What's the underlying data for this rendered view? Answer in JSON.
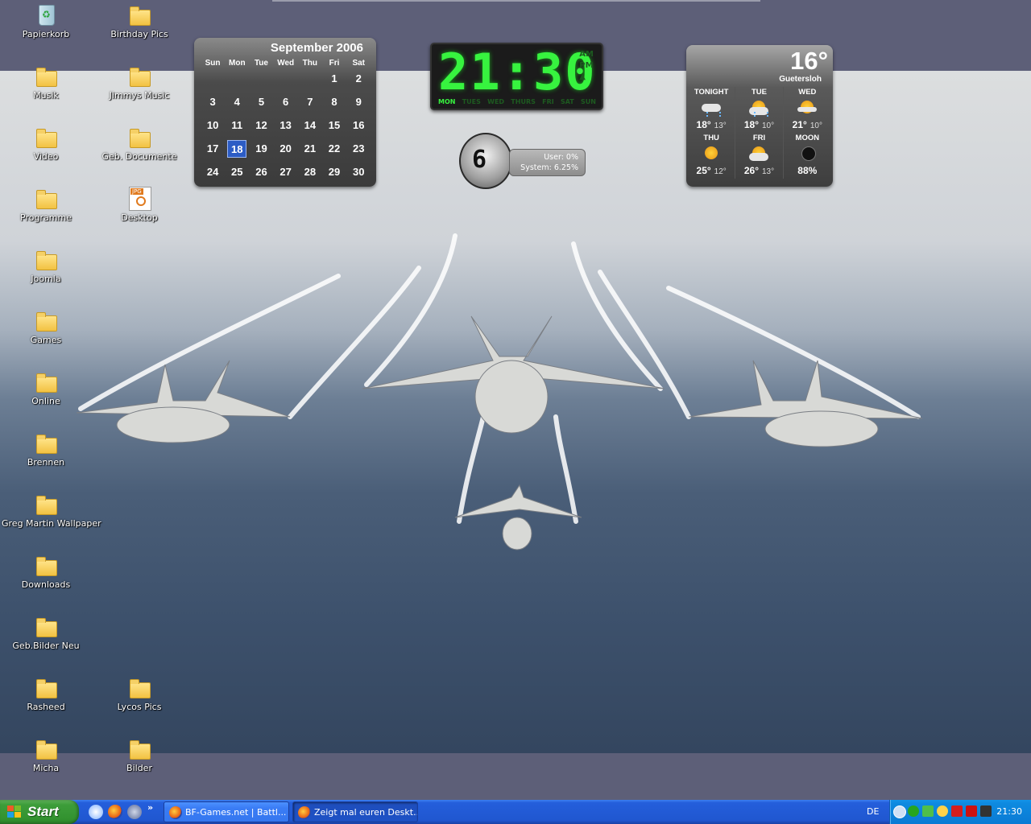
{
  "desktop_icons": [
    {
      "label": "Papierkorb",
      "type": "recycle-bin"
    },
    {
      "label": "Birthday Pics",
      "type": "folder"
    },
    {
      "label": "Musik",
      "type": "folder"
    },
    {
      "label": "Jimmys Music",
      "type": "folder"
    },
    {
      "label": "Video",
      "type": "folder"
    },
    {
      "label": "Geb. Documente",
      "type": "folder"
    },
    {
      "label": "Programme",
      "type": "folder"
    },
    {
      "label": "Desktop",
      "type": "jpg-file"
    },
    {
      "label": "Joomla",
      "type": "folder"
    },
    {
      "label": "Games",
      "type": "folder"
    },
    {
      "label": "Online",
      "type": "folder"
    },
    {
      "label": "Brennen",
      "type": "folder"
    },
    {
      "label": "Greg Martin Wallpaper",
      "type": "folder"
    },
    {
      "label": "Downloads",
      "type": "folder"
    },
    {
      "label": "Geb.Bilder Neu",
      "type": "folder"
    },
    {
      "label": "Rasheed",
      "type": "folder"
    },
    {
      "label": "Lycos Pics",
      "type": "folder"
    },
    {
      "label": "Micha",
      "type": "folder"
    },
    {
      "label": "Bilder",
      "type": "folder"
    }
  ],
  "calendar": {
    "month": "September 2006",
    "weekdays": [
      "Sun",
      "Mon",
      "Tue",
      "Wed",
      "Thu",
      "Fri",
      "Sat"
    ],
    "days": [
      "",
      "",
      "",
      "",
      "",
      "1",
      "2",
      "3",
      "4",
      "5",
      "6",
      "7",
      "8",
      "9",
      "10",
      "11",
      "12",
      "13",
      "14",
      "15",
      "16",
      "17",
      "18",
      "19",
      "20",
      "21",
      "22",
      "23",
      "24",
      "25",
      "26",
      "27",
      "28",
      "29",
      "30"
    ],
    "today": "18",
    "highlight_color": "#2c5cc5"
  },
  "clock": {
    "time": "21:30",
    "am": "AM",
    "pm": "PM",
    "days": [
      "MON",
      "TUES",
      "WED",
      "THURS",
      "FRI",
      "SAT",
      "SUN"
    ],
    "active_day": "MON",
    "digit_color": "#37f33f"
  },
  "cpu_meter": {
    "value": "6",
    "user": "User: 0%",
    "system": "System: 6.25%"
  },
  "weather": {
    "current_temp": "16°",
    "city": "Guetersloh",
    "forecast": [
      {
        "day": "TONIGHT",
        "high": "18°",
        "low": "13°",
        "icon": "rain-cloud-icon"
      },
      {
        "day": "TUE",
        "high": "18°",
        "low": "10°",
        "icon": "sun-rain-icon"
      },
      {
        "day": "WED",
        "high": "21°",
        "low": "10°",
        "icon": "sun-cloud-icon"
      },
      {
        "day": "THU",
        "high": "25°",
        "low": "12°",
        "icon": "sun-icon"
      },
      {
        "day": "FRI",
        "high": "26°",
        "low": "13°",
        "icon": "sun-cloud-icon"
      },
      {
        "day": "MOON",
        "high": "88%",
        "low": "",
        "icon": "moon-icon"
      }
    ]
  },
  "taskbar": {
    "start_label": "Start",
    "chevron": "»",
    "tasks": [
      {
        "label": "BF-Games.net | Battl...",
        "active": false
      },
      {
        "label": "Zeigt mal euren Deskt...",
        "active": true
      }
    ],
    "language": "DE",
    "time": "21:30"
  }
}
